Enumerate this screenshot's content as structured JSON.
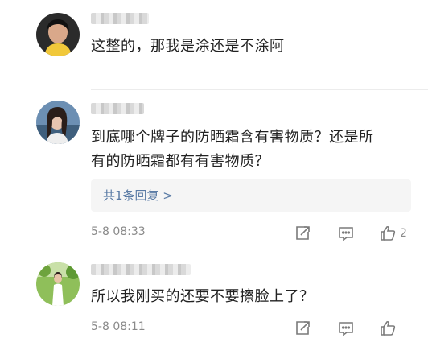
{
  "comments": [
    {
      "text": "这整的，那我是涂还是不涂阿"
    },
    {
      "text_line1": "到底哪个牌子的防晒霜含有害物质？还是所",
      "text_line2": "有的防晒霜都有有害物质？",
      "replies_label": "共1条回复 >",
      "time": "5-8 08:33",
      "like_count": "2"
    },
    {
      "text": "所以我刚买的还要不要擦脸上了？",
      "time": "5-8 08:11",
      "like_count": ""
    }
  ],
  "icons": {
    "share": "share-icon",
    "comment": "comment-icon",
    "like": "thumbs-up-icon"
  }
}
